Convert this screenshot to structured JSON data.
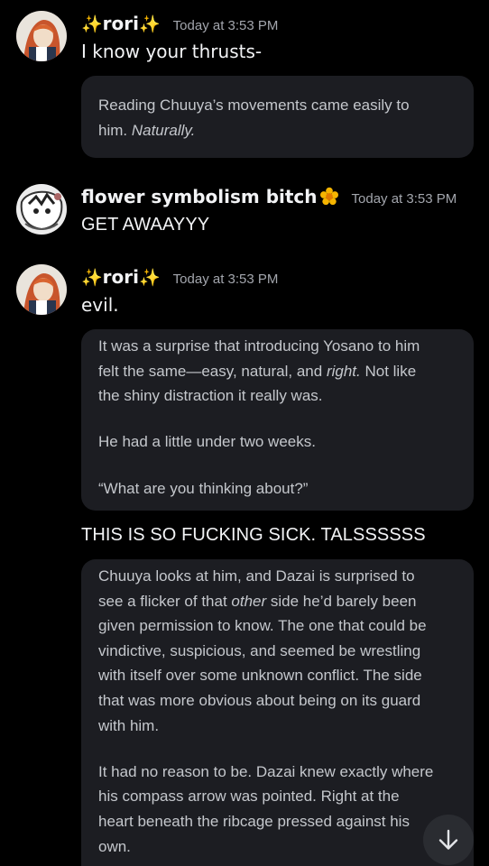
{
  "messages": [
    {
      "author": "rori",
      "sparkle": "✨",
      "timestamp": "Today at 3:53 PM",
      "text": "I know your thrusts-",
      "quote": {
        "lines": [
          "Reading Chuuya’s movements came easily to",
          "him. ",
          "Naturally."
        ]
      }
    },
    {
      "author": "flower symbolism bitch",
      "timestamp": "Today at 3:53 PM",
      "text": "GET AWAAYYY"
    },
    {
      "author": "rori",
      "sparkle": "✨",
      "timestamp": "Today at 3:53 PM",
      "text": "evil.",
      "quote": {
        "p1_l1": "It was a surprise that introducing Yosano to him",
        "p1_l2a": "felt the same—easy, natural, and ",
        "p1_l2b": "right.",
        "p1_l2c": " Not like",
        "p1_l3": "the shiny distraction it really was.",
        "p2": "He had a little under two weeks.",
        "p3": "“What are you thinking about?”"
      },
      "followup": "THIS IS SO FUCKING SICK. TALSSSSSS",
      "quote2": {
        "p1_l1": "Chuuya looks at him, and Dazai is surprised to",
        "p1_l2a": "see a flicker of that ",
        "p1_l2b": "other",
        "p1_l2c": " side he’d barely been",
        "p1_l3": "given permission to know. The one that could be",
        "p1_l4": "vindictive, suspicious, and seemed be wrestling",
        "p1_l5": "with itself over some unknown conflict. The side",
        "p1_l6": "that was more obvious about being on its guard",
        "p1_l7": "with him.",
        "p2_l1": "It had no reason to be. Dazai knew exactly where",
        "p2_l2": "his compass arrow was pointed. Right at the",
        "p2_l3": "heart beneath the ribcage pressed against his",
        "p2_l4": "own."
      }
    }
  ],
  "scroll_button_icon": "arrow-down-icon",
  "colors": {
    "background": "#000000",
    "quote_bg": "#1c1d22",
    "sparkle": "#f5c542",
    "flower": "#f5b400"
  }
}
